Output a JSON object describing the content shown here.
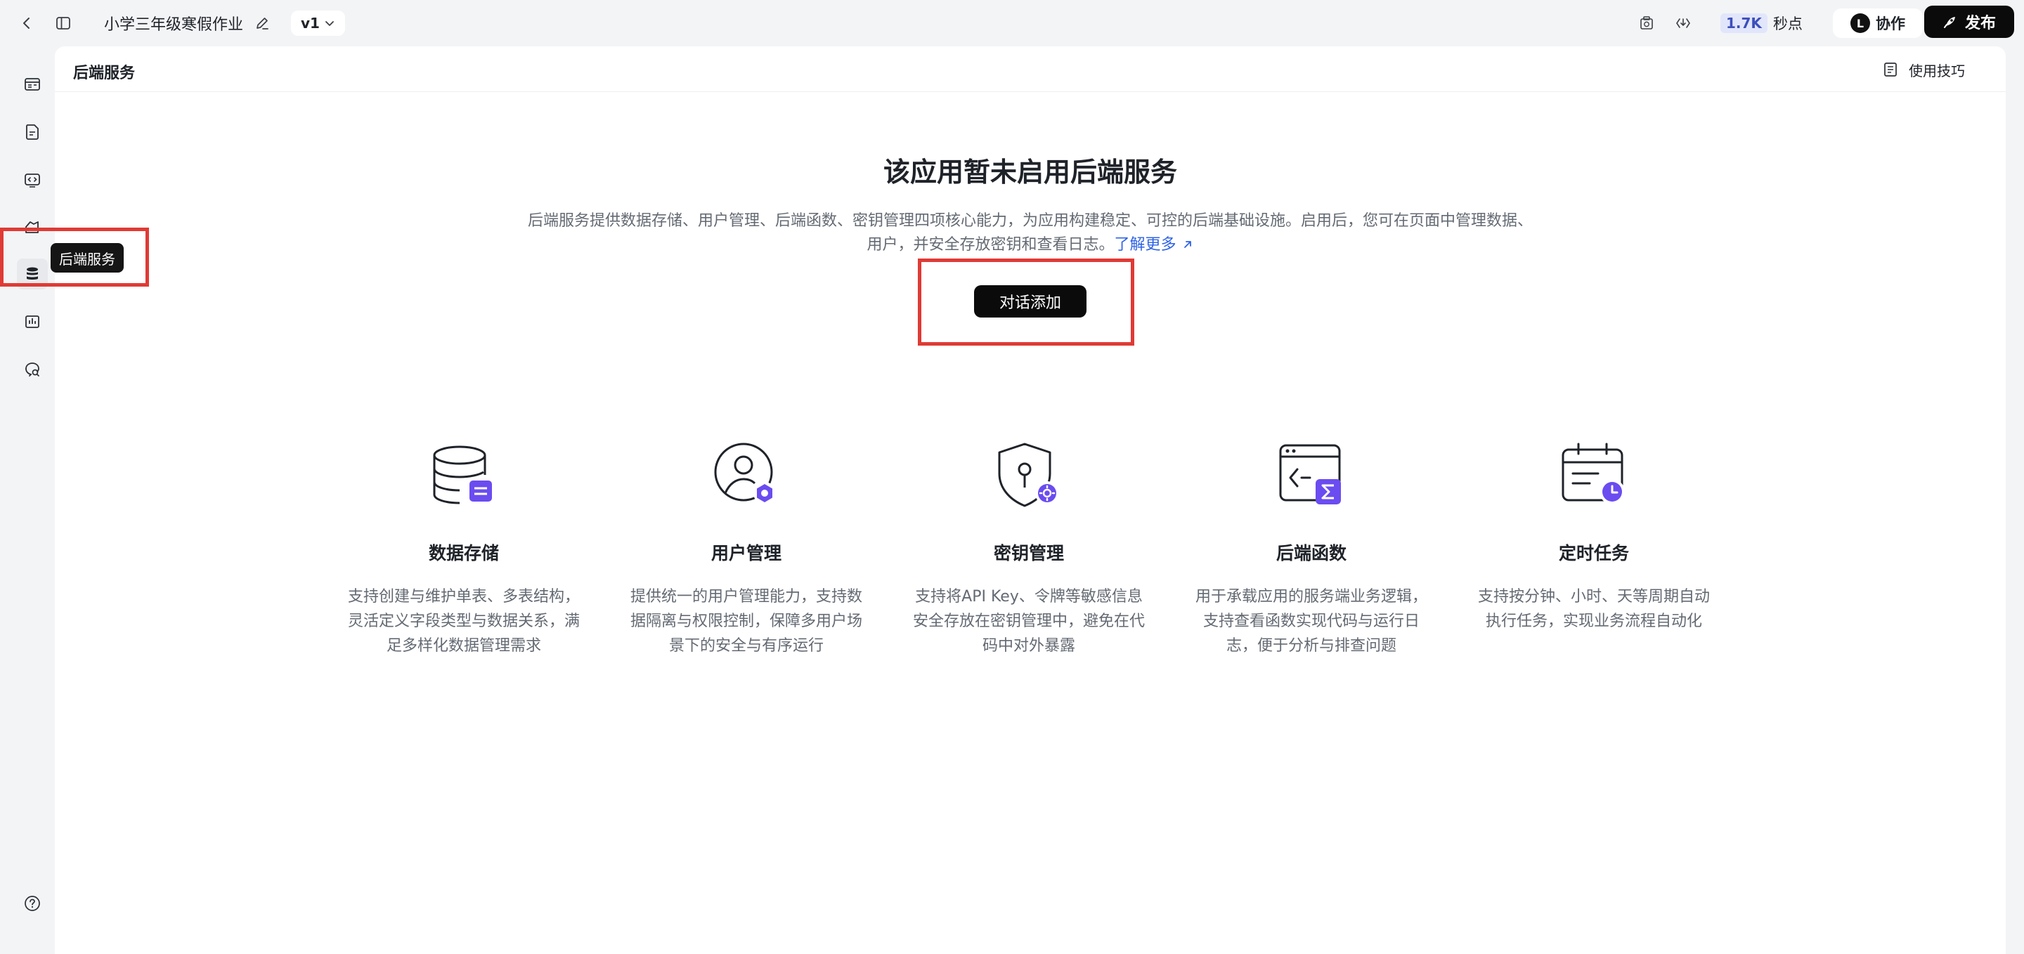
{
  "header": {
    "app_title": "小学三年级寒假作业",
    "version": "v1",
    "credits_count": "1.7K",
    "credits_unit": "秒点",
    "collab_label": "协作",
    "avatar_letter": "L",
    "publish_label": "发布"
  },
  "sidebar": {
    "tooltip": "后端服务",
    "items": [
      {
        "name": "layout-icon"
      },
      {
        "name": "document-icon"
      },
      {
        "name": "code-icon"
      },
      {
        "name": "plugin-icon"
      },
      {
        "name": "database-icon"
      },
      {
        "name": "analytics-icon"
      },
      {
        "name": "search-chat-icon"
      }
    ],
    "help_icon": "help-icon"
  },
  "panel": {
    "title": "后端服务",
    "tips_label": "使用技巧",
    "hero_title": "该应用暂未启用后端服务",
    "hero_desc_line1": "后端服务提供数据存储、用户管理、后端函数、密钥管理四项核心能力，为应用构建稳定、可控的后端基础设施。启用后，您可在页面中管理数据、",
    "hero_desc_line2": "用户，并安全存放密钥和查看日志。",
    "learn_more": "了解更多",
    "add_button": "对话添加"
  },
  "features": [
    {
      "title": "数据存储",
      "desc": [
        "支持创建与维护单表、多表结构，",
        "灵活定义字段类型与数据关系，满",
        "足多样化数据管理需求"
      ]
    },
    {
      "title": "用户管理",
      "desc": [
        "提供统一的用户管理能力，支持数",
        "据隔离与权限控制，保障多用户场",
        "景下的安全与有序运行"
      ]
    },
    {
      "title": "密钥管理",
      "desc": [
        "支持将API Key、令牌等敏感信息",
        "安全存放在密钥管理中，避免在代",
        "码中对外暴露"
      ]
    },
    {
      "title": "后端函数",
      "desc": [
        "用于承载应用的服务端业务逻辑，",
        "支持查看函数实现代码与运行日",
        "志，便于分析与排查问题"
      ]
    },
    {
      "title": "定时任务",
      "desc": [
        "支持按分钟、小时、天等周期自动",
        "执行任务，实现业务流程自动化"
      ]
    }
  ],
  "colors": {
    "accent_link": "#2f63e6",
    "highlight": "#e03a35",
    "badge_purple": "#6b4cf0",
    "primary_button": "#0b0b0b"
  }
}
